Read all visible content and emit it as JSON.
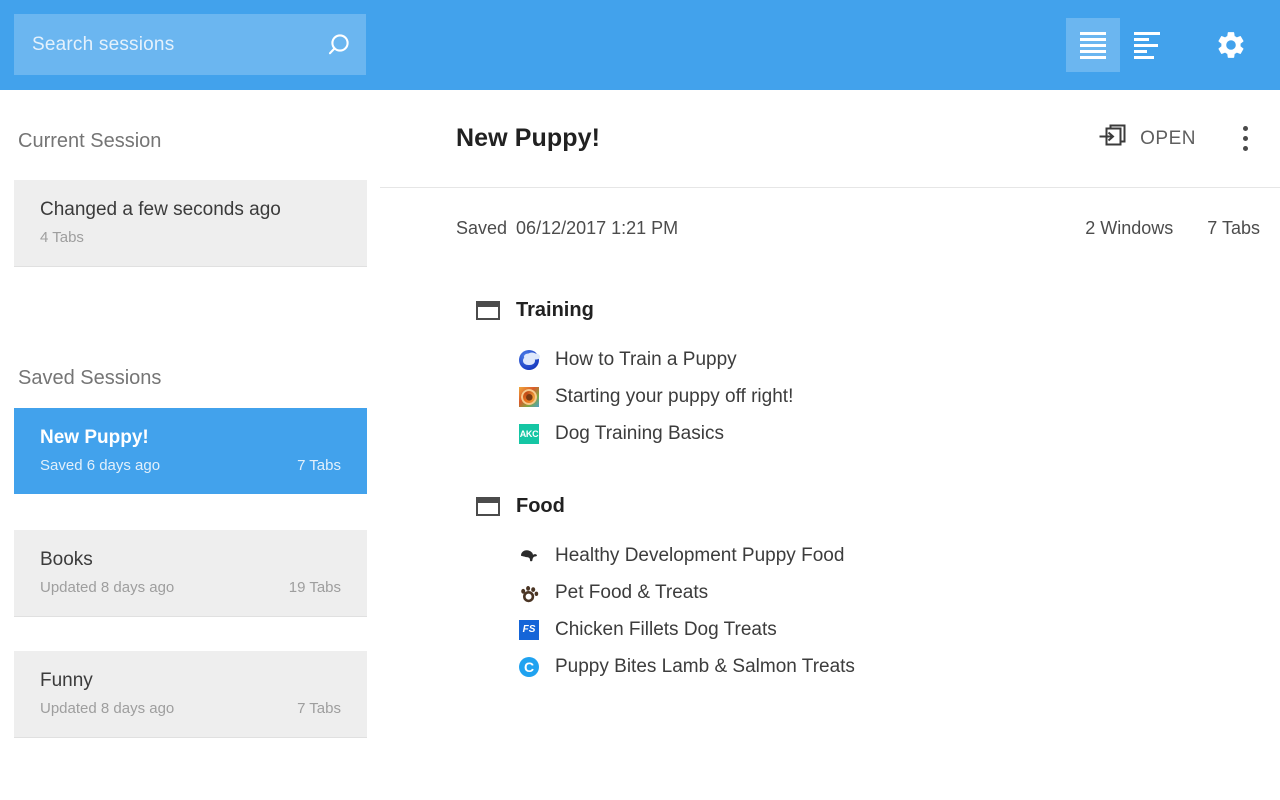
{
  "header": {
    "search": {
      "placeholder": "Search sessions",
      "value": "",
      "icon": "search-icon"
    },
    "icons": [
      {
        "name": "list-view-icon",
        "label": "List view",
        "selected": true
      },
      {
        "name": "detail-view-icon",
        "label": "Detail view",
        "selected": false
      },
      {
        "name": "gear-icon",
        "label": "Settings",
        "selected": false
      }
    ],
    "accent_color": "#42a2ec",
    "search_bg": "rgba(255,255,255,0.22)"
  },
  "sidebar": {
    "current_section_title": "Current Session",
    "current_session": {
      "title": "Changed a few seconds ago",
      "tabs": "4 Tabs"
    },
    "saved_section_title": "Saved Sessions",
    "saved_sessions": [
      {
        "title": "New Puppy!",
        "subtitle": "Saved 6 days ago",
        "tabs": "7 Tabs",
        "selected": true
      },
      {
        "title": "Books",
        "subtitle": "Updated 8 days ago",
        "tabs": "19 Tabs",
        "selected": false
      },
      {
        "title": "Funny",
        "subtitle": "Updated 8 days ago",
        "tabs": "7 Tabs",
        "selected": false
      }
    ]
  },
  "main": {
    "title": "New Puppy!",
    "open_label": "OPEN",
    "open_icon": "open-in-window-icon",
    "menu_icon": "more-vertical-icon",
    "meta": {
      "saved_label": "Saved",
      "saved_date": "06/12/2017 1:21 PM",
      "windows_count": "2 Windows",
      "tabs_count": "7 Tabs"
    },
    "windows": [
      {
        "name": "Training",
        "tabs": [
          {
            "title": "How to Train a Puppy",
            "favicon": "paw-blue-icon"
          },
          {
            "title": "Starting your puppy off right!",
            "favicon": "swirl-orange-icon"
          },
          {
            "title": "Dog Training Basics",
            "favicon": "akc-icon",
            "favicon_text": "AKC"
          }
        ]
      },
      {
        "name": "Food",
        "tabs": [
          {
            "title": "Healthy Development Puppy Food",
            "favicon": "bear-dark-icon"
          },
          {
            "title": "Pet Food & Treats",
            "favicon": "paw-brown-icon"
          },
          {
            "title": "Chicken Fillets Dog Treats",
            "favicon": "fs-icon",
            "favicon_text": "FS"
          },
          {
            "title": "Puppy Bites Lamb & Salmon Treats",
            "favicon": "c-blue-icon",
            "favicon_text": "C"
          }
        ]
      }
    ]
  }
}
